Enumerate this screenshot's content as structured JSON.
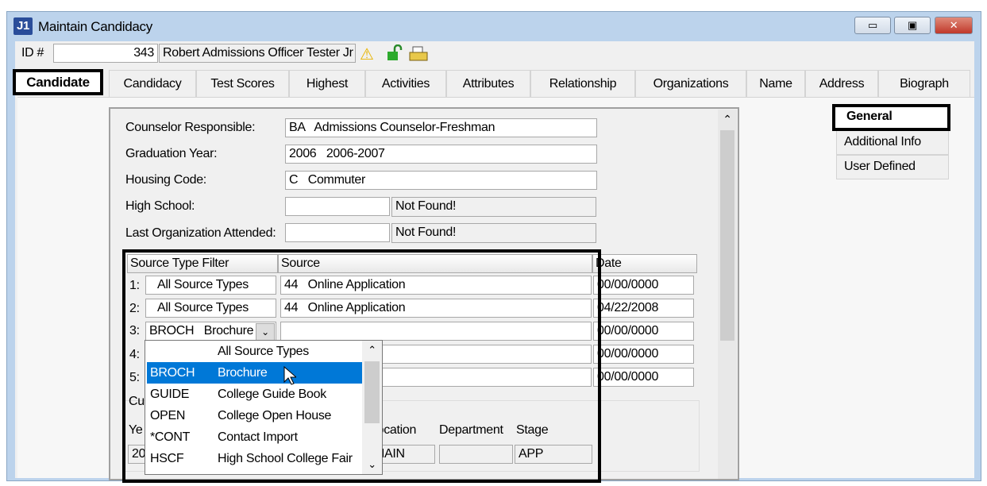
{
  "window": {
    "title": "Maintain Candidacy",
    "app_icon": "J1",
    "minimize": "▭",
    "restore": "▣",
    "close": "✕"
  },
  "header": {
    "id_label": "ID #",
    "id_value": "343",
    "name_value": "Robert Admissions Officer Tester Jr"
  },
  "tabs": [
    "Candidate",
    "Candidacy",
    "Test Scores",
    "Highest",
    "Activities",
    "Attributes",
    "Relationship",
    "Organizations",
    "Name",
    "Address",
    "Biograph"
  ],
  "side_tabs": [
    "General",
    "Additional Info",
    "User Defined"
  ],
  "form": {
    "counselor_label": "Counselor Responsible:",
    "counselor_value": "BA   Admissions Counselor-Freshman",
    "grad_label": "Graduation Year:",
    "grad_value": "2006   2006-2007",
    "housing_label": "Housing Code:",
    "housing_value": "C   Commuter",
    "hs_label": "High School:",
    "hs_value": "",
    "hs_status": "Not Found!",
    "lastorg_label": "Last Organization Attended:",
    "lastorg_value": "",
    "lastorg_status": "Not Found!"
  },
  "sources": {
    "headers": [
      "Source Type Filter",
      "Source",
      "Date"
    ],
    "rows": [
      {
        "num": "1:",
        "filter": "All Source Types",
        "source": "44   Online Application",
        "date": "00/00/0000"
      },
      {
        "num": "2:",
        "filter": "All Source Types",
        "source": "44   Online Application",
        "date": "04/22/2008"
      },
      {
        "num": "3:",
        "filter": "BROCH   Brochure",
        "source": "",
        "date": "00/00/0000"
      },
      {
        "num": "4:",
        "filter": "",
        "source": "",
        "date": "00/00/0000"
      },
      {
        "num": "5:",
        "filter": "",
        "source": "",
        "date": "00/00/0000"
      }
    ]
  },
  "dropdown": {
    "items": [
      {
        "code": "",
        "desc": "All Source Types"
      },
      {
        "code": "BROCH",
        "desc": "Brochure"
      },
      {
        "code": "GUIDE",
        "desc": "College Guide Book"
      },
      {
        "code": "OPEN",
        "desc": "College Open House"
      },
      {
        "code": "*CONT",
        "desc": "Contact Import"
      },
      {
        "code": "HSCF",
        "desc": "High School College Fair"
      }
    ],
    "selected": 1
  },
  "current": {
    "group_label": "Cu",
    "year_label": "Ye",
    "year_value": "20",
    "location_label": "Location",
    "location_value": "MAIN",
    "department_label": "Department",
    "department_value": "",
    "stage_label": "Stage",
    "stage_value": "APP"
  },
  "colors": {
    "selection": "#0078d7",
    "highlight_border": "#000000"
  }
}
